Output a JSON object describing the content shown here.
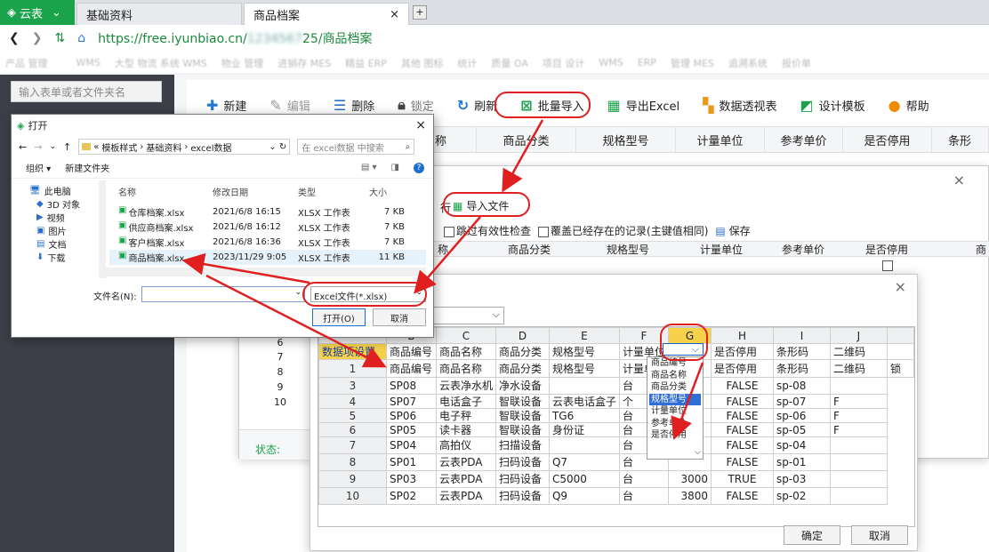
{
  "browser": {
    "app_tab": "云表",
    "tabs": [
      {
        "label": "基础资料"
      },
      {
        "label": "商品档案",
        "close": "×"
      }
    ],
    "url_prefix": "https://free.iyunbiao.cn/",
    "url_suffix": "25/商品档案",
    "bookmarks": [
      "产品 管理",
      "",
      "WMS",
      "大型 物流 系统 WMS",
      "物业 管理",
      "进销存 MES",
      "精益 ERP",
      "其他 图标",
      "统计",
      "质量 OA",
      "项目 设计",
      "WMS",
      "ERP",
      "管理 MES",
      "追溯系统",
      "报价单"
    ]
  },
  "sidebar": {
    "search_placeholder": "输入表单或者文件夹名"
  },
  "toolbar": {
    "items": [
      {
        "icon": "plus-icon",
        "label": "新建"
      },
      {
        "icon": "edit-icon",
        "label": "编辑"
      },
      {
        "icon": "delete-icon",
        "label": "删除"
      },
      {
        "icon": "lock-icon",
        "label": "锁定"
      },
      {
        "icon": "refresh-icon",
        "label": "刷新"
      },
      {
        "icon": "batch-import-icon",
        "label": "批量导入"
      },
      {
        "icon": "excel-icon",
        "label": "导出Excel"
      },
      {
        "icon": "pivot-icon",
        "label": "数据透视表"
      },
      {
        "icon": "design-icon",
        "label": "设计模板"
      },
      {
        "icon": "help-icon",
        "label": "帮助"
      }
    ]
  },
  "main_grid": {
    "columns": [
      "称",
      "商品分类",
      "规格型号",
      "计量单位",
      "参考单价",
      "是否停用",
      "条形"
    ]
  },
  "import_dialog": {
    "import_file": "导入文件",
    "toolbar_left": "行",
    "skip_check": "跳过有效性检查",
    "overwrite": "覆盖已经存在的记录(主键值相同)",
    "save": "保存",
    "columns": [
      "称",
      "商品分类",
      "规格型号",
      "计量单位",
      "参考单价",
      "是否停用",
      "商"
    ],
    "status_label": "状态:",
    "row_numbers": [
      "6",
      "7",
      "8",
      "9",
      "10"
    ]
  },
  "mapping_dialog": {
    "col_letters": [
      "B",
      "C",
      "D",
      "E",
      "F",
      "G",
      "H",
      "I",
      "J"
    ],
    "mapping_row_label": "数据项设置",
    "mapping_row": [
      "商品编号",
      "商品名称",
      "商品分类",
      "规格型号",
      "计量单位",
      "",
      "是否停用",
      "条形码",
      "二维码"
    ],
    "header_row": [
      "商品编号",
      "商品名称",
      "商品分类",
      "规格型号",
      "计量单",
      "",
      "是否停用",
      "条形码",
      "二维码",
      "锁"
    ],
    "rows": [
      {
        "n": "3",
        "c": [
          "SP08",
          "云表净水机",
          "净水设备",
          "",
          "台",
          "",
          "FALSE",
          "sp-08",
          ""
        ]
      },
      {
        "n": "4",
        "c": [
          "SP07",
          "电话盒子",
          "智联设备",
          "云表电话盒子",
          "个",
          "",
          "FALSE",
          "sp-07",
          "F"
        ]
      },
      {
        "n": "5",
        "c": [
          "SP06",
          "电子秤",
          "智联设备",
          "TG6",
          "台",
          "",
          "FALSE",
          "sp-06",
          "F"
        ]
      },
      {
        "n": "6",
        "c": [
          "SP05",
          "读卡器",
          "智联设备",
          "身份证",
          "台",
          "",
          "FALSE",
          "sp-05",
          "F"
        ]
      },
      {
        "n": "7",
        "c": [
          "SP04",
          "高拍仪",
          "扫描设备",
          "",
          "台",
          "",
          "FALSE",
          "sp-04",
          ""
        ]
      },
      {
        "n": "8",
        "c": [
          "SP01",
          "云表PDA",
          "扫码设备",
          "Q7",
          "台",
          "",
          "FALSE",
          "sp-01",
          ""
        ]
      },
      {
        "n": "9",
        "c": [
          "SP03",
          "云表PDA",
          "扫码设备",
          "C5000",
          "台",
          "3000",
          "TRUE",
          "sp-03",
          ""
        ]
      },
      {
        "n": "10",
        "c": [
          "SP02",
          "云表PDA",
          "扫码设备",
          "Q9",
          "台",
          "3800",
          "FALSE",
          "sp-02",
          ""
        ]
      }
    ],
    "dropdown_options": [
      "商品编号",
      "商品名称",
      "商品分类",
      "规格型号",
      "计量单位",
      "参考单价",
      "是否停用"
    ],
    "dropdown_selected": "规格型号",
    "ok": "确定",
    "cancel": "取消",
    "close": "×"
  },
  "file_dialog": {
    "title": "打开",
    "close": "×",
    "path": [
      "«",
      "模板样式",
      "›",
      "基础资料",
      "›",
      "excel数据"
    ],
    "search_placeholder": "在 excel数据 中搜索",
    "organize": "组织 ▾",
    "new_folder": "新建文件夹",
    "tree": [
      "此电脑",
      "3D 对象",
      "视频",
      "图片",
      "文档",
      "下载"
    ],
    "headers": [
      "名称",
      "修改日期",
      "类型",
      "大小"
    ],
    "files": [
      {
        "name": "仓库档案.xlsx",
        "date": "2021/6/8 16:15",
        "type": "XLSX 工作表",
        "size": "7 KB"
      },
      {
        "name": "供应商档案.xlsx",
        "date": "2021/6/8 16:12",
        "type": "XLSX 工作表",
        "size": "7 KB"
      },
      {
        "name": "客户档案.xlsx",
        "date": "2021/6/8 16:36",
        "type": "XLSX 工作表",
        "size": "7 KB"
      },
      {
        "name": "商品档案.xlsx",
        "date": "2023/11/29 9:05",
        "type": "XLSX 工作表",
        "size": "11 KB"
      }
    ],
    "filename_label": "文件名(N):",
    "filter": "Excel文件(*.xlsx)",
    "open": "打开(O)",
    "cancel": "取消"
  },
  "colors": {
    "accent_green": "#1aa34a",
    "annotation_red": "#e02020",
    "sidebar": "#3c3f48"
  }
}
